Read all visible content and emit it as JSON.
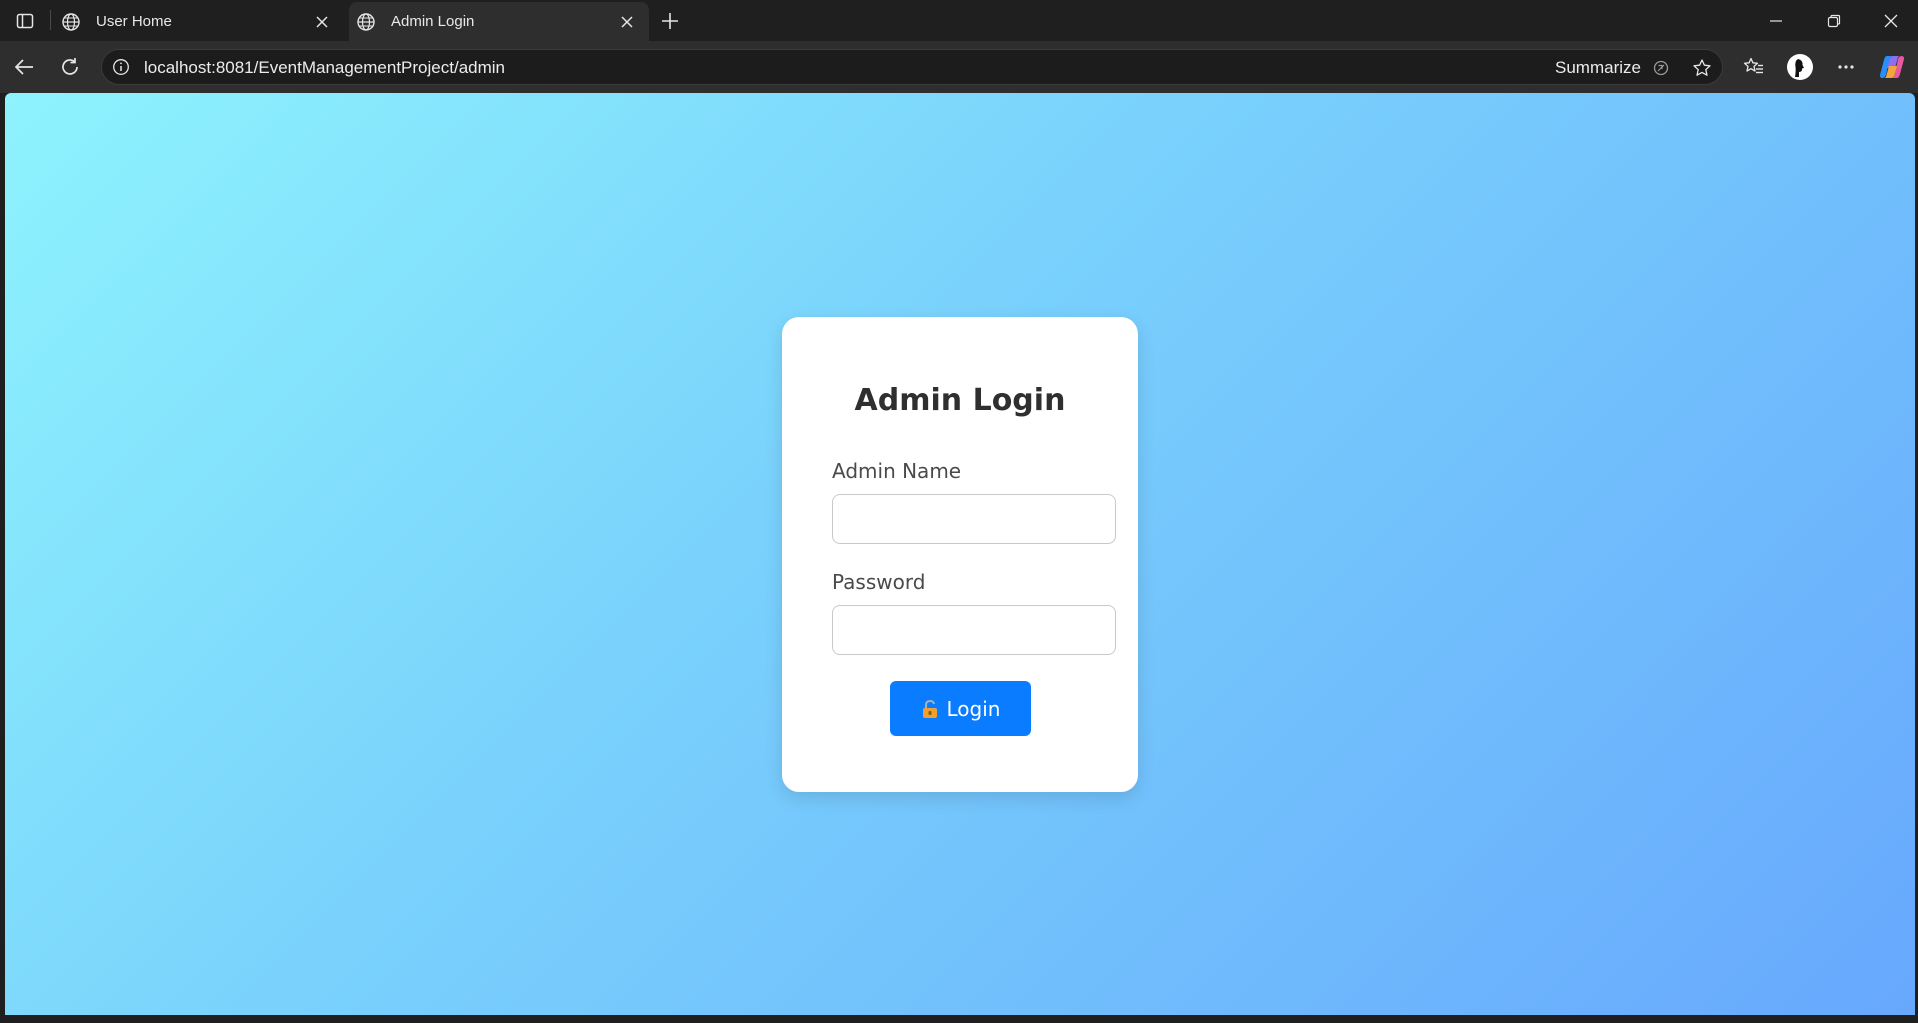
{
  "browser": {
    "tabs": [
      {
        "title": "User Home",
        "icon": "globe-icon",
        "active": false
      },
      {
        "title": "Admin Login",
        "icon": "globe-icon",
        "active": true
      }
    ],
    "address": {
      "url": "localhost:8081/EventManagementProject/admin",
      "summarize_label": "Summarize"
    }
  },
  "page": {
    "title": "Admin Login",
    "fields": {
      "name_label": "Admin Name",
      "name_value": "",
      "password_label": "Password",
      "password_value": ""
    },
    "login_label": "Login",
    "colors": {
      "button": "#0a7cff",
      "gradient_start": "#8ef3fd",
      "gradient_end": "#67a8fd"
    }
  }
}
